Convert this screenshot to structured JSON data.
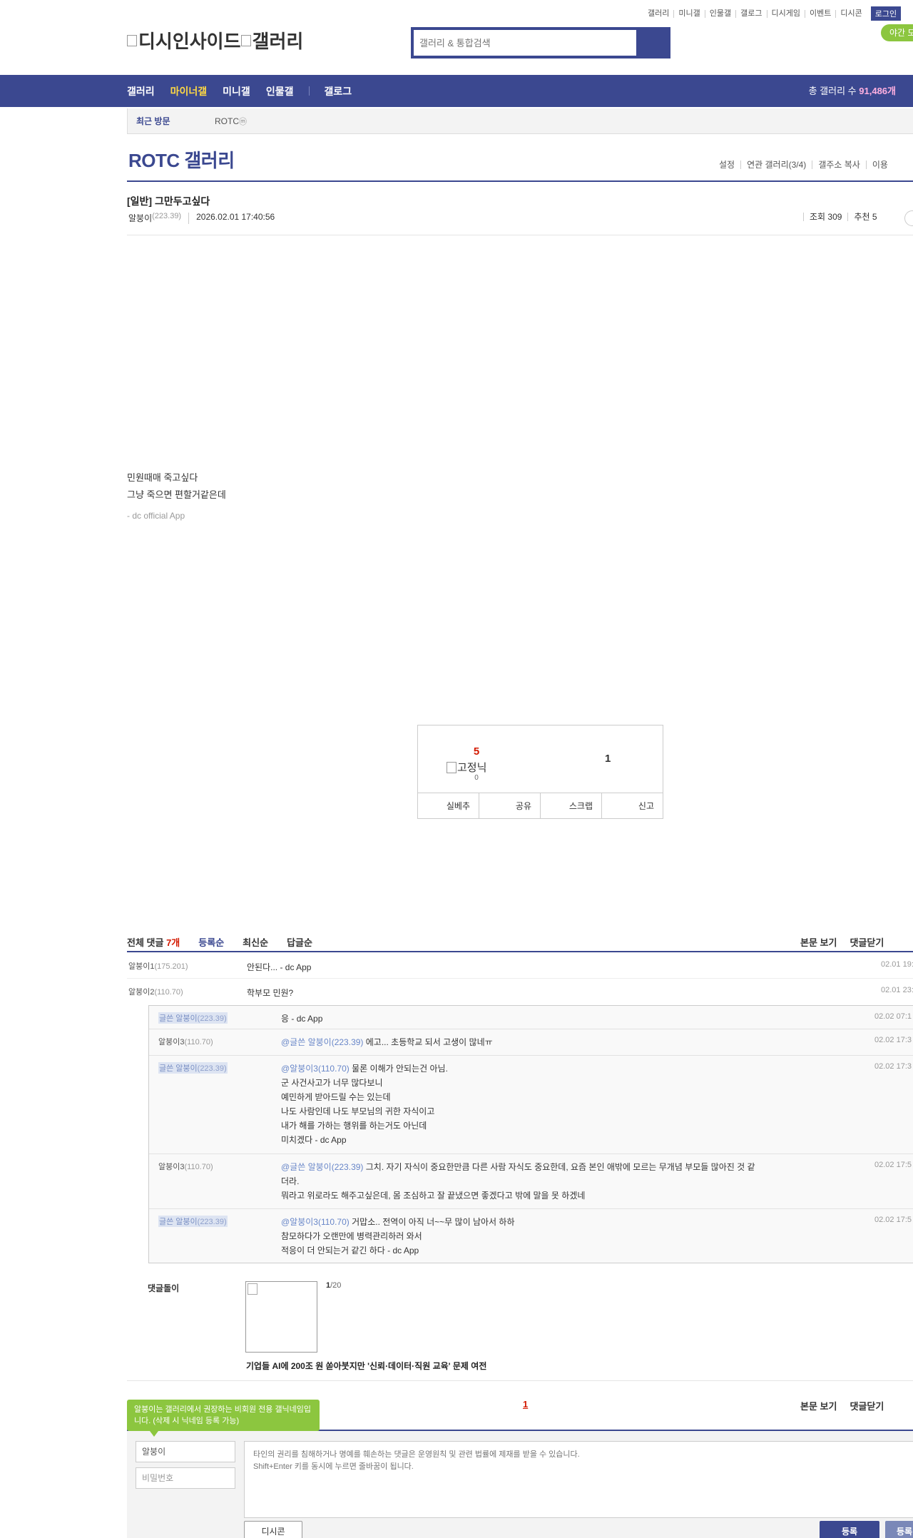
{
  "util": {
    "links": [
      "갤러리",
      "미니갤",
      "인물갤",
      "갤로그",
      "디시게임",
      "이벤트",
      "디시콘"
    ],
    "login": "로그인",
    "night": "야간 모드"
  },
  "logo": {
    "alt1": "디시인사이드",
    "alt2": "갤러리"
  },
  "search": {
    "placeholder": "갤러리 & 통합검색"
  },
  "nav": {
    "items": [
      "갤러리",
      "마이너갤",
      "미니갤",
      "인물갤"
    ],
    "gallog": "갤로그",
    "total_label": "총 갤러리 수",
    "total_value": "91,486개"
  },
  "recent": {
    "title": "최근 방문",
    "gallery": "ROTC",
    "badge": "ⓜ"
  },
  "gallery": {
    "title": "ROTC 갤러리",
    "menu": [
      "설정",
      "연관 갤러리(3/4)",
      "갤주소 복사",
      "이용"
    ]
  },
  "post": {
    "title": "[일반] 그만두고싶다",
    "nick": "알붕이",
    "ip": "(223.39)",
    "date": "2026.02.01 17:40:56",
    "views": "조회 309",
    "recommend": "추천 5",
    "lines": [
      "민원때매 죽고싶다",
      "그냥 죽으면 편할거같은데"
    ],
    "app": "- dc official App"
  },
  "vote": {
    "up": "5",
    "fixed": "고정닉",
    "fixed_count": "0",
    "down": "1",
    "buttons": [
      "실베추",
      "공유",
      "스크랩",
      "신고"
    ]
  },
  "comments_header": {
    "label": "전체 댓글",
    "count": "7개",
    "sorts": [
      "등록순",
      "최신순",
      "답글순"
    ],
    "right": [
      "본문 보기",
      "댓글닫기"
    ]
  },
  "comments": [
    {
      "nick": "알붕이1",
      "ip": "(175.201)",
      "text": "안된다... - dc App",
      "date": "02.01 19:"
    },
    {
      "nick": "알붕이2",
      "ip": "(110.70)",
      "text": "학부모 민원?",
      "date": "02.01 23:"
    }
  ],
  "replies": [
    {
      "nick": "글쓴 알붕이",
      "ip": "(223.39)",
      "mention": "",
      "lines": [
        "응 - dc App"
      ],
      "date": "02.02 07:1"
    },
    {
      "nick": "알붕이3",
      "ip": "(110.70)",
      "mention": "@글쓴 알붕이(223.39)",
      "lines": [
        " 에고... 초등학교 되서 고생이 많네ㅠ"
      ],
      "date": "02.02 17:3"
    },
    {
      "nick": "글쓴 알붕이",
      "ip": "(223.39)",
      "mention": "@알붕이3(110.70)",
      "lines": [
        " 물론 이해가 안되는건 아님.",
        "군 사건사고가 너무 많다보니",
        "예민하게 받아드릴 수는 있는데",
        "나도 사람인데 나도 부모님의 귀한 자식이고",
        "내가 해를 가하는 행위를 하는거도 아닌데",
        "미치겠다 - dc App"
      ],
      "date": "02.02 17:3"
    },
    {
      "nick": "알붕이3",
      "ip": "(110.70)",
      "mention": "@글쓴 알붕이(223.39)",
      "lines": [
        " 그치. 자기 자식이 중요한만큼 다른 사람 자식도 중요한데, 요즘 본인 애밖에 모르는 무개념 부모들 많아진 것 같",
        "더라.",
        "뭐라고 위로라도 해주고싶은데, 몸 조심하고 잘 끝냈으면 좋겠다고 밖에 말을 못 하겠네"
      ],
      "date": "02.02 17:5"
    },
    {
      "nick": "글쓴 알붕이",
      "ip": "(223.39)",
      "mention": "@알붕이3(110.70)",
      "lines": [
        " 거맙소.. 전역이 아직 너~~무 많이 남아서 하하",
        "참모하다가 오랜만에 병력관리하러 와서",
        "적응이 더 안되는거 같긴 하다 - dc App"
      ],
      "date": "02.02 17:5"
    }
  ],
  "dolly": {
    "label": "댓글돌이",
    "page_current": "1",
    "page_total": "/20",
    "caption": "기업들 AI에 200조 원 쏟아붓지만 '신뢰·데이터·직원 교육' 문제 여전"
  },
  "pager": {
    "current": "1"
  },
  "write": {
    "tooltip": "알붕이는 갤러리에서 권장하는 비회원 전용 갤닉네임입니다. (삭제 시 닉네임 등록 가능)",
    "nick": "알붕이",
    "password": "비밀번호",
    "placeholder": "타인의 권리를 침해하거나 명예를 훼손하는 댓글은 운영원칙 및 관련 법률에 제재를 받을 수 있습니다.\nShift+Enter 키를 동시에 누르면 줄바꿈이 됩니다.",
    "dccon": "디시콘",
    "submit": "등록",
    "submit2": "등록"
  },
  "colors": {
    "brand": "#3b4890",
    "accent_yellow": "#ffd943",
    "green": "#8cc63f",
    "red": "#d31900"
  }
}
